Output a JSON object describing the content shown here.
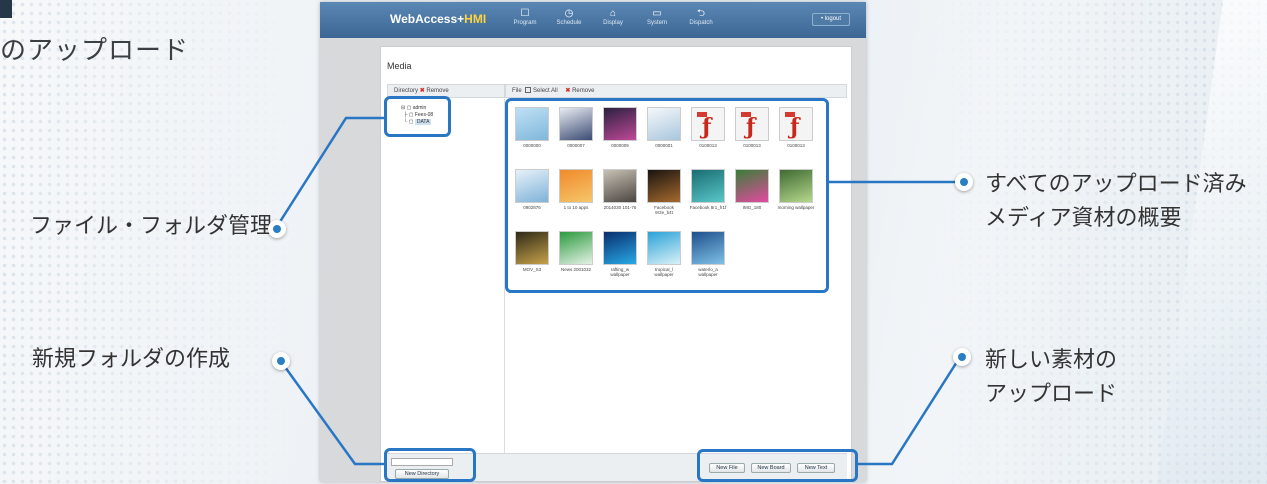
{
  "heading": "のアップロード",
  "callouts": {
    "file_folder": "ファイル・フォルダ管理",
    "new_folder": "新規フォルダの作成",
    "overview_line1": "すべてのアップロード済み",
    "overview_line2": "メディア資材の概要",
    "upload_line1": "新しい素材の",
    "upload_line2": "アップロード"
  },
  "app": {
    "brand_main": "WebAccess+",
    "brand_accent": "HMI",
    "nav": [
      {
        "icon": "program-icon",
        "glyph": "☐",
        "label": "Program"
      },
      {
        "icon": "schedule-icon",
        "glyph": "◷",
        "label": "Schedule"
      },
      {
        "icon": "display-icon",
        "glyph": "⌂",
        "label": "Display"
      },
      {
        "icon": "system-icon",
        "glyph": "▭",
        "label": "System"
      },
      {
        "icon": "dispatch-icon",
        "glyph": "⮌",
        "label": "Dispatch"
      }
    ],
    "logout": "• logout",
    "media_title": "Media",
    "directory_label": "Directory",
    "remove_label": "Remove",
    "file_label": "File",
    "select_all": "Select All",
    "tree": [
      "admin",
      "Fees-08",
      "DATA"
    ],
    "files": [
      {
        "name": "0000000",
        "kind": "img",
        "c1": "#bfe0f5",
        "c2": "#7fb7da"
      },
      {
        "name": "0000007",
        "kind": "img",
        "c1": "#e9ecf2",
        "c2": "#3b4b74"
      },
      {
        "name": "0000009",
        "kind": "img",
        "c1": "#2b2140",
        "c2": "#c04898"
      },
      {
        "name": "0000001",
        "kind": "img",
        "c1": "#f5f8fb",
        "c2": "#a9c6dd"
      },
      {
        "name": "0100013",
        "kind": "pdf"
      },
      {
        "name": "0100013",
        "kind": "pdf"
      },
      {
        "name": "0100013",
        "kind": "pdf"
      },
      {
        "name": "0902876",
        "kind": "img",
        "c1": "#e6f1f9",
        "c2": "#7fb2d8"
      },
      {
        "name": "1 to 10 apps",
        "kind": "img",
        "c1": "#f08a2c",
        "c2": "#f6c66a"
      },
      {
        "name": "2014030 101-76",
        "kind": "img",
        "c1": "#c9c1b5",
        "c2": "#4a4540"
      },
      {
        "name": "Facebook 9r2e_b4t",
        "kind": "img",
        "c1": "#1a1410",
        "c2": "#a56a2e"
      },
      {
        "name": "Facebook 8r1_fr1f",
        "kind": "img",
        "c1": "#1a6d72",
        "c2": "#59c7c9"
      },
      {
        "name": "IMG_180",
        "kind": "img",
        "c1": "#3a7e38",
        "c2": "#e34aa0"
      },
      {
        "name": "morning wallpaper",
        "kind": "img",
        "c1": "#3e6a32",
        "c2": "#b7d88d"
      },
      {
        "name": "MOV_S3",
        "kind": "img",
        "c1": "#2e2a18",
        "c2": "#c7a14a"
      },
      {
        "name": "News 2001032",
        "kind": "img",
        "c1": "#2c9a3e",
        "c2": "#e4f2e6"
      },
      {
        "name": "rafting_w wallpaper",
        "kind": "img",
        "c1": "#0a2e6e",
        "c2": "#28a9e6"
      },
      {
        "name": "tropical_l wallpaper",
        "kind": "img",
        "c1": "#2aa1d8",
        "c2": "#d9f1f7"
      },
      {
        "name": "waterlo_a wallpaper",
        "kind": "img",
        "c1": "#1f4f8a",
        "c2": "#7fc1e8"
      }
    ],
    "new_directory": "New Directory",
    "new_file": "New File",
    "new_board": "New Board",
    "new_text": "New Text"
  },
  "colors": {
    "accent": "#2876c4",
    "nav": "#4a77a5",
    "brand_accent": "#ffd23c"
  }
}
